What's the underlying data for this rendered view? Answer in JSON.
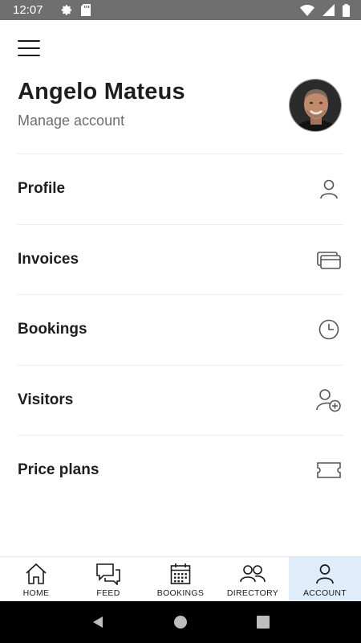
{
  "status_bar": {
    "time": "12:07",
    "left_icons": [
      "gear-icon",
      "sd-card-icon"
    ],
    "right_icons": [
      "wifi-icon",
      "signal-icon",
      "battery-icon"
    ]
  },
  "header": {
    "menu_icon": "hamburger-icon"
  },
  "profile": {
    "name": "Angelo Mateus",
    "subtitle": "Manage account",
    "avatar": "user-photo"
  },
  "menu": {
    "items": [
      {
        "label": "Profile",
        "icon": "person-icon"
      },
      {
        "label": "Invoices",
        "icon": "cards-icon"
      },
      {
        "label": "Bookings",
        "icon": "clock-icon"
      },
      {
        "label": "Visitors",
        "icon": "add-person-icon"
      },
      {
        "label": "Price plans",
        "icon": "ticket-icon"
      }
    ]
  },
  "bottom_nav": {
    "items": [
      {
        "label": "HOME",
        "icon": "home-icon",
        "active": false
      },
      {
        "label": "FEED",
        "icon": "chat-bubbles-icon",
        "active": false
      },
      {
        "label": "BOOKINGS",
        "icon": "calendar-icon",
        "active": false
      },
      {
        "label": "DIRECTORY",
        "icon": "people-icon",
        "active": false
      },
      {
        "label": "ACCOUNT",
        "icon": "person-icon",
        "active": true
      }
    ],
    "active_color": "#deedf9"
  },
  "system_nav": {
    "buttons": [
      "back-icon",
      "home-circle-icon",
      "recents-icon"
    ]
  }
}
